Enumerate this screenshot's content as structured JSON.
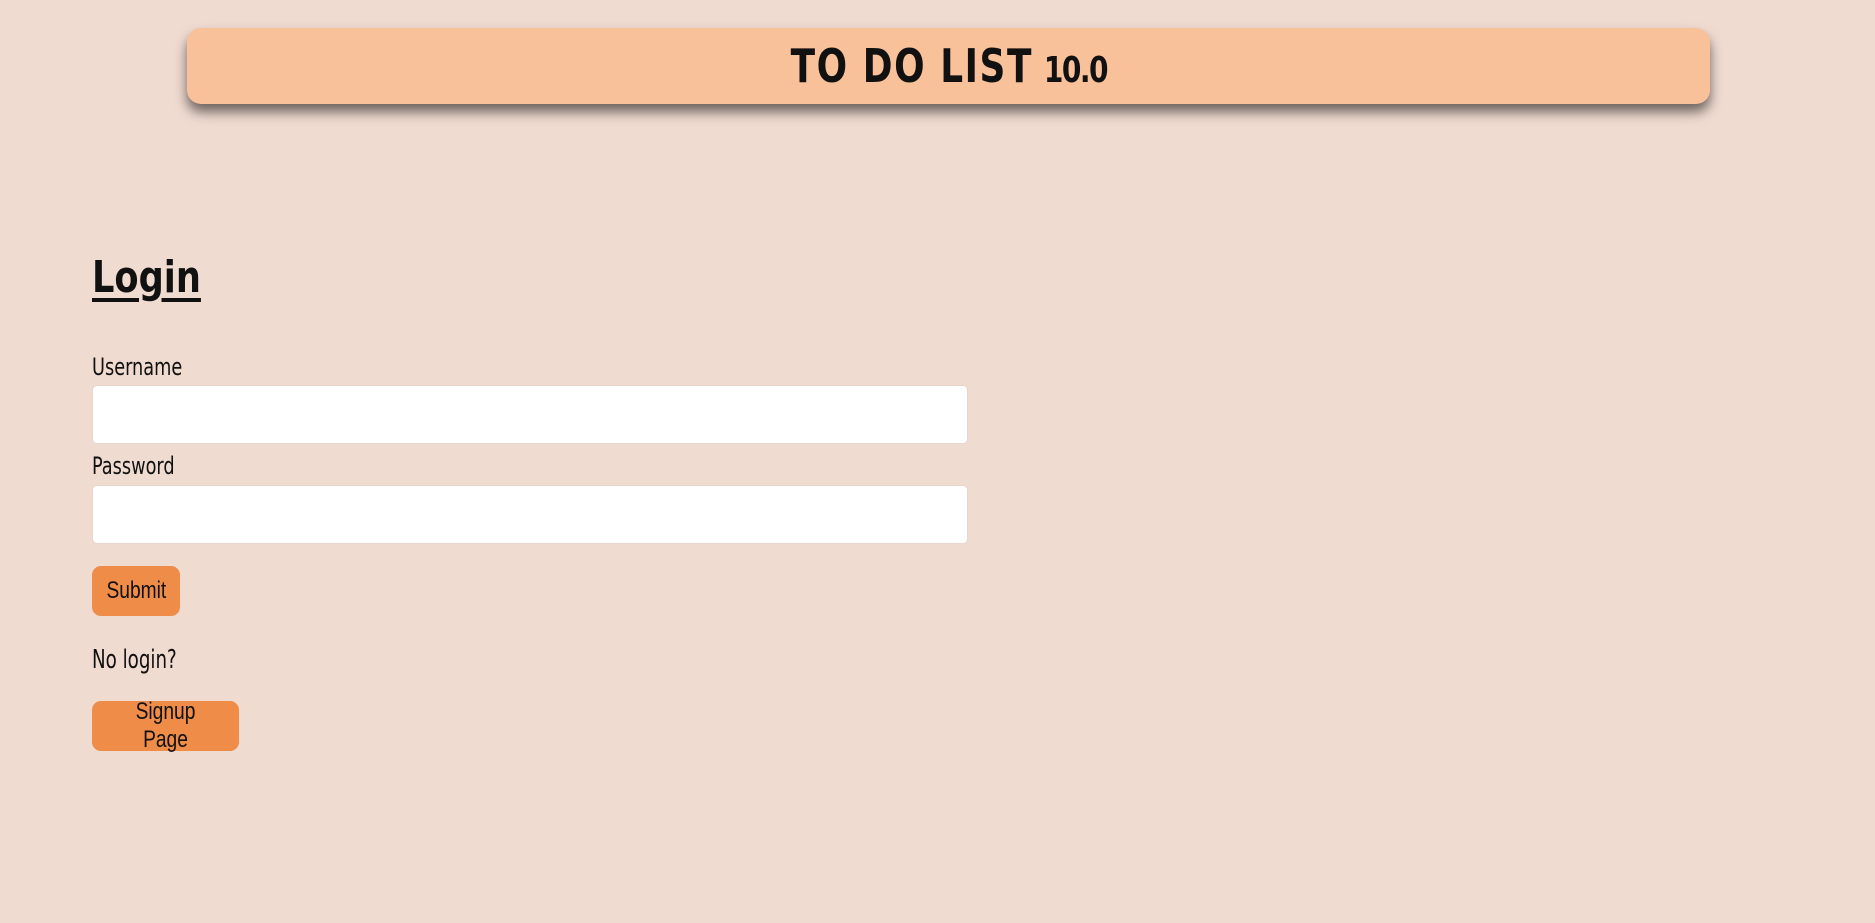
{
  "header": {
    "title": "TO DO LIST",
    "version": "10.0"
  },
  "login": {
    "heading": "Login",
    "username_label": "Username",
    "username_value": "",
    "password_label": "Password",
    "password_value": "",
    "submit_label": "Submit",
    "no_login_text": "No login?",
    "signup_label": "Signup Page"
  },
  "colors": {
    "background": "#f0dbd1",
    "header_bg": "#f9c199",
    "button_bg": "#ee8c48",
    "input_bg": "#ffffff"
  }
}
